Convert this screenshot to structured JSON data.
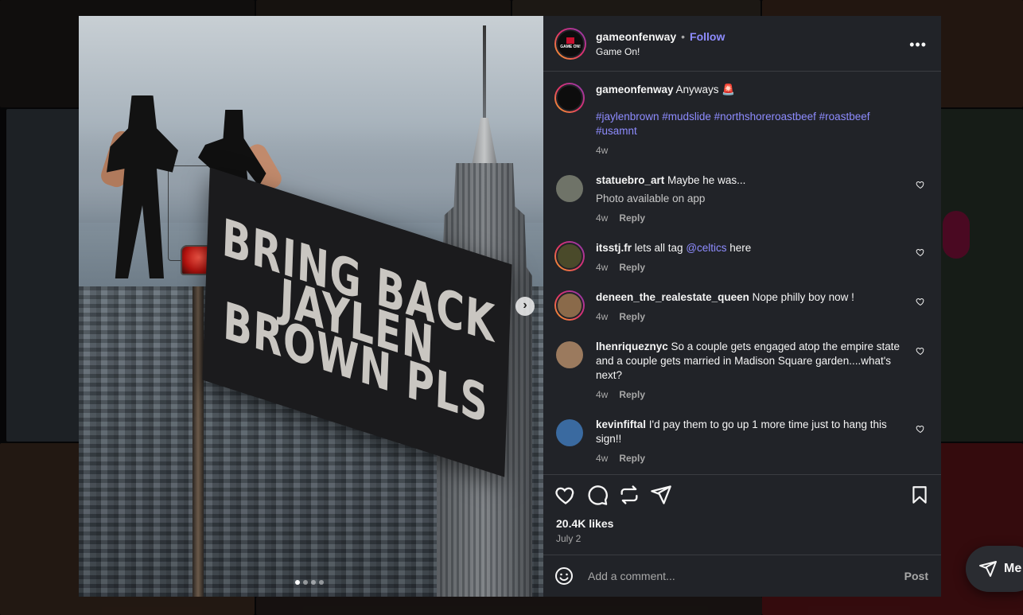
{
  "post": {
    "author": "gameonfenway",
    "separator": "•",
    "follow_label": "Follow",
    "subtitle": "Game On!",
    "avatar_text": "GAME ON!",
    "more_label": "•••",
    "flag_lines": [
      "BRING BACK",
      "JAYLEN",
      "BROWN PLS"
    ],
    "next_label": "›",
    "slide_count": 4,
    "active_slide": 1,
    "likes": "20.4K likes",
    "date": "July 2"
  },
  "caption": {
    "user": "gameonfenway",
    "text": " Anyways 🚨",
    "tags": "#jaylenbrown #mudslide #northshoreroastbeef #roastbeef #usamnt",
    "time": "4w"
  },
  "comments": [
    {
      "user": "statuebro_art",
      "text": " Maybe he was...",
      "note": "Photo available on app",
      "time": "4w",
      "reply": "Reply",
      "avatar_color": "#6f7368",
      "ring": false
    },
    {
      "user": "itsstj.fr",
      "text_pre": " lets all tag ",
      "mention": "@celtics",
      "text_post": " here",
      "time": "4w",
      "reply": "Reply",
      "avatar_color": "#4a4a2a",
      "ring": true
    },
    {
      "user": "deneen_the_realestate_queen",
      "text": " Nope philly boy now !",
      "time": "4w",
      "reply": "Reply",
      "avatar_color": "#8a6a4a",
      "ring": true
    },
    {
      "user": "lhenriqueznyc",
      "text": " So a couple gets engaged atop the empire state and a couple gets married in Madison Square garden....what's next?",
      "time": "4w",
      "reply": "Reply",
      "avatar_color": "#9b7a5e",
      "ring": false
    },
    {
      "user": "kevinfiftal",
      "text": " I'd pay them to go up 1 more time just to hang this sign!!",
      "time": "4w",
      "reply": "Reply",
      "avatar_color": "#3a6aa0",
      "ring": false
    }
  ],
  "composer": {
    "placeholder": "Add a comment...",
    "post_label": "Post"
  },
  "messages": {
    "label": "Me"
  },
  "colors": {
    "accent": "#8e8cff",
    "panel_bg": "#212328",
    "page_bg": "#111214"
  },
  "icons": {
    "like": "heart-icon",
    "comment": "comment-icon",
    "repost": "repost-icon",
    "share": "share-icon",
    "save": "bookmark-icon",
    "emoji": "emoji-icon",
    "more": "more-icon",
    "next": "chevron-right-icon",
    "messages": "send-icon"
  }
}
